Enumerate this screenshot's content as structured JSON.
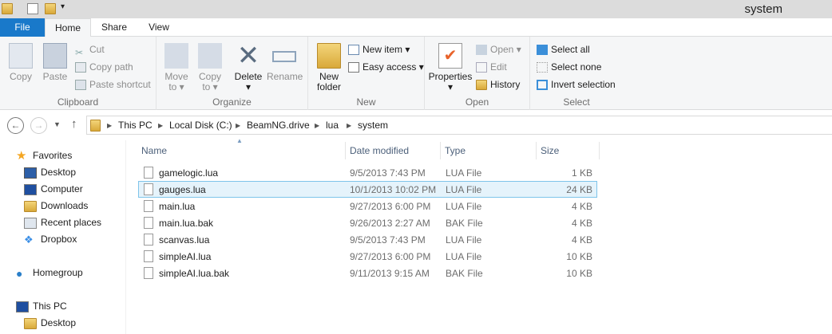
{
  "window": {
    "title": "system"
  },
  "tabs": [
    "File",
    "Home",
    "Share",
    "View"
  ],
  "ribbon": {
    "clipboard": {
      "label": "Clipboard",
      "copy": "Copy",
      "paste": "Paste",
      "cut": "Cut",
      "copy_path": "Copy path",
      "paste_shortcut": "Paste shortcut"
    },
    "organize": {
      "label": "Organize",
      "move_to": [
        "Move",
        "to"
      ],
      "copy_to": [
        "Copy",
        "to"
      ],
      "delete": "Delete",
      "rename": "Rename"
    },
    "new": {
      "label": "New",
      "new_folder": [
        "New",
        "folder"
      ],
      "new_item": "New item",
      "easy_access": "Easy access"
    },
    "open": {
      "label": "Open",
      "properties": "Properties",
      "open": "Open",
      "edit": "Edit",
      "history": "History"
    },
    "select": {
      "label": "Select",
      "select_all": "Select all",
      "select_none": "Select none",
      "invert": "Invert selection"
    }
  },
  "breadcrumb": [
    "This PC",
    "Local Disk (C:)",
    "BeamNG.drive",
    "lua",
    "system"
  ],
  "sidebar": {
    "favorites": "Favorites",
    "fav_items": [
      "Desktop",
      "Computer",
      "Downloads",
      "Recent places",
      "Dropbox"
    ],
    "homegroup": "Homegroup",
    "this_pc": "This PC",
    "pc_items": [
      "Desktop"
    ]
  },
  "columns": [
    "Name",
    "Date modified",
    "Type",
    "Size"
  ],
  "files": [
    {
      "name": "gamelogic.lua",
      "date": "9/5/2013 7:43 PM",
      "type": "LUA File",
      "size": "1 KB"
    },
    {
      "name": "gauges.lua",
      "date": "10/1/2013 10:02 PM",
      "type": "LUA File",
      "size": "24 KB",
      "selected": true
    },
    {
      "name": "main.lua",
      "date": "9/27/2013 6:00 PM",
      "type": "LUA File",
      "size": "4 KB"
    },
    {
      "name": "main.lua.bak",
      "date": "9/26/2013 2:27 AM",
      "type": "BAK File",
      "size": "4 KB"
    },
    {
      "name": "scanvas.lua",
      "date": "9/5/2013 7:43 PM",
      "type": "LUA File",
      "size": "4 KB"
    },
    {
      "name": "simpleAI.lua",
      "date": "9/27/2013 6:00 PM",
      "type": "LUA File",
      "size": "10 KB"
    },
    {
      "name": "simpleAI.lua.bak",
      "date": "9/11/2013 9:15 AM",
      "type": "BAK File",
      "size": "10 KB"
    }
  ]
}
